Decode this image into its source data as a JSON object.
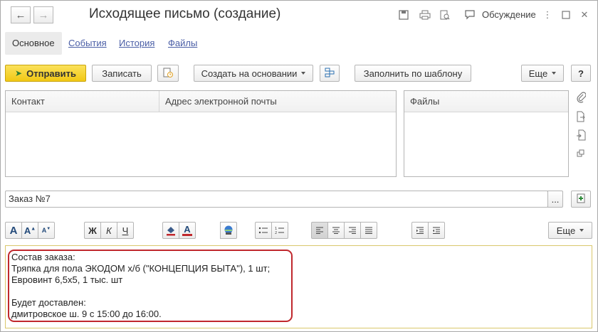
{
  "window": {
    "title": "Исходящее письмо  (создание)",
    "discussion_label": "Обсуждение"
  },
  "tabs": [
    {
      "label": "Основное",
      "active": true
    },
    {
      "label": "События",
      "active": false
    },
    {
      "label": "История",
      "active": false
    },
    {
      "label": "Файлы",
      "active": false
    }
  ],
  "toolbar": {
    "send_label": "Отправить",
    "save_label": "Записать",
    "create_based_label": "Создать на основании",
    "fill_template_label": "Заполнить по шаблону",
    "more_label": "Еще",
    "help_label": "?"
  },
  "recipients_table": {
    "columns": [
      "Контакт",
      "Адрес электронной почты"
    ],
    "rows": []
  },
  "files_table": {
    "columns": [
      "Файлы"
    ],
    "rows": []
  },
  "subject": {
    "value": "Заказ №7",
    "select_label": "..."
  },
  "format_toolbar": {
    "bold_label": "Ж",
    "italic_label": "К",
    "underline_label": "Ч",
    "font_color_label": "A",
    "more_label": "Еще"
  },
  "body_lines": [
    "Состав заказа:",
    "Тряпка для пола ЭКОДОМ х/б (\"КОНЦЕПЦИЯ БЫТА\"), 1 шт;",
    "Евровинт 6,5х5, 1 тыс. шт",
    "",
    "Будет доставлен:",
    "дмитровское ш. 9 с 15:00 до 16:00."
  ],
  "colors": {
    "primary_button": "#f5d02a",
    "link": "#4a5ea6",
    "highlight_border": "#c0282d",
    "editor_border": "#d9c76b"
  }
}
